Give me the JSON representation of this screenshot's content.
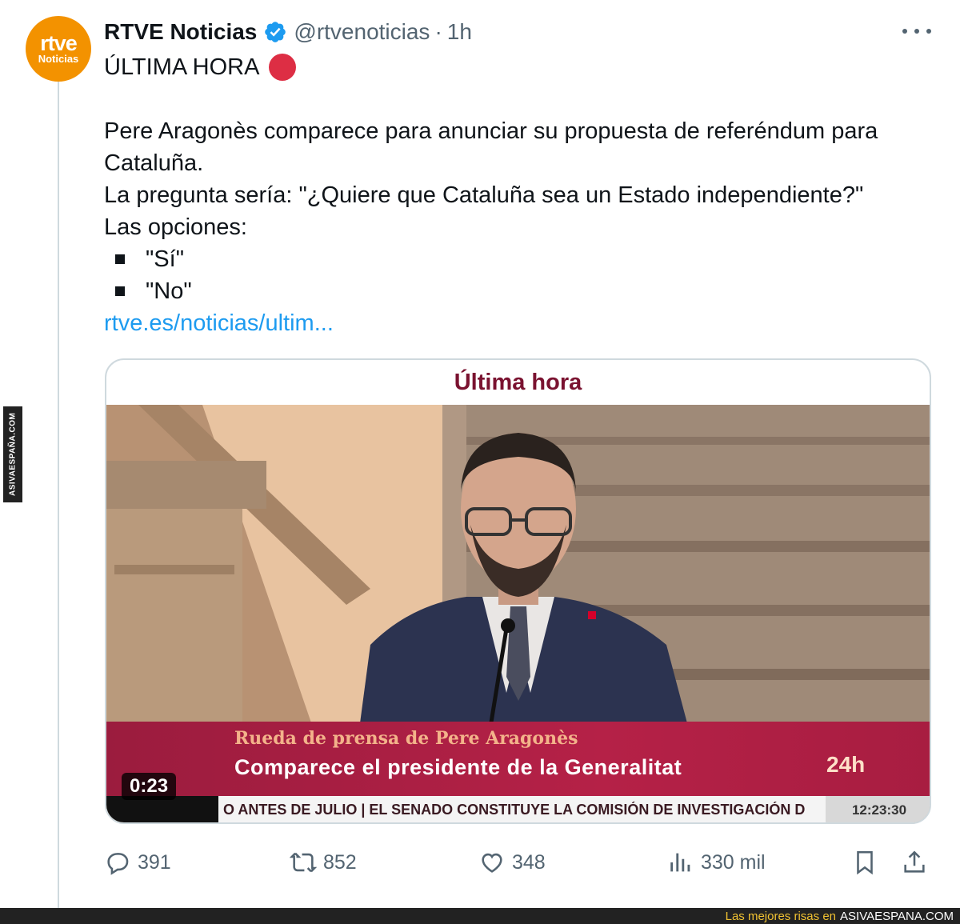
{
  "watermark": {
    "side_text": "ASIVAESPAÑA.COM"
  },
  "tweet": {
    "avatar": {
      "line1": "rtve",
      "line2": "Noticias"
    },
    "author_name": "RTVE Noticias",
    "handle": "@rtvenoticias",
    "separator": "·",
    "time": "1h",
    "headline": "ÚLTIMA HORA",
    "paragraph1": "Pere Aragonès comparece para anunciar su propuesta de referéndum para Cataluña.",
    "paragraph2": "La pregunta sería: \"¿Quiere que Cataluña sea un Estado independiente?\"",
    "options_intro": "Las opciones:",
    "options": [
      "\"Sí\"",
      "\"No\""
    ],
    "link": "rtve.es/noticias/ultim..."
  },
  "media": {
    "header": "Última hora",
    "lower_third_line1": "Rueda de prensa de Pere Aragonès",
    "lower_third_line2": "Comparece el presidente de la Generalitat",
    "channel_badge": "24h",
    "ticker_text": "O ANTES DE JULIO  |  EL SENADO CONSTITUYE LA COMISIÓN DE INVESTIGACIÓN D",
    "ticker_time": "12:23:30",
    "duration": "0:23"
  },
  "actions": {
    "replies": "391",
    "reposts": "852",
    "likes": "348",
    "views": "330 mil"
  },
  "footer": {
    "prefix": "Las mejores risas en",
    "site": "ASIVAESPANA.COM"
  },
  "colors": {
    "accent_link": "#1d9bf0",
    "avatar_orange": "#f39200",
    "lower_third": "#b52147",
    "card_header": "#7a1230"
  },
  "icons": [
    "verified-badge-icon",
    "more-options-icon",
    "red-circle-icon",
    "reply-icon",
    "repost-icon",
    "like-icon",
    "views-icon",
    "bookmark-icon",
    "share-icon"
  ]
}
